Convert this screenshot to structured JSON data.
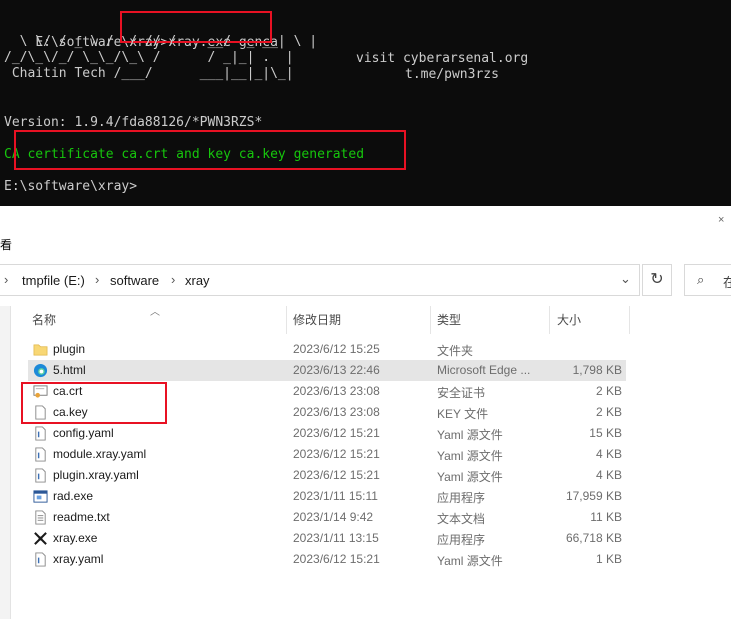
{
  "console": {
    "cmd_prompt": "E:\\software\\xray>",
    "cmd_text": "xray.exe genca",
    "banner": "  \\ \\/ / _ \\ /  / // /    __/  _ __| \\ |\n/_/\\_\\/_/ \\_\\_/\\_\\ /      / _|_| .  |\n Chaitin Tech /___/      ___|__|_|\\_|",
    "visit": "visit cyberarsenal.org",
    "tme": "t.me/pwn3rzs",
    "version": "Version: 1.9.4/fda88126/*PWN3RZS*",
    "ca_message": "CA certificate ca.crt and key ca.key generated",
    "prompt_end": "E:\\software\\xray>"
  },
  "explorer": {
    "view_label": "看",
    "breadcrumb": [
      "tmpfile (E:)",
      "software",
      "xray"
    ],
    "search_placeholder": "在",
    "columns": {
      "name": "名称",
      "date": "修改日期",
      "type": "类型",
      "size": "大小"
    },
    "files": [
      {
        "name": "plugin",
        "date": "2023/6/12 15:25",
        "type": "文件夹",
        "size": "",
        "icon": "folder-icon"
      },
      {
        "name": "5.html",
        "date": "2023/6/13 22:46",
        "type": "Microsoft Edge ...",
        "size": "1,798 KB",
        "icon": "edge-icon"
      },
      {
        "name": "ca.crt",
        "date": "2023/6/13 23:08",
        "type": "安全证书",
        "size": "2 KB",
        "icon": "certificate-icon"
      },
      {
        "name": "ca.key",
        "date": "2023/6/13 23:08",
        "type": "KEY 文件",
        "size": "2 KB",
        "icon": "file-icon"
      },
      {
        "name": "config.yaml",
        "date": "2023/6/12 15:21",
        "type": "Yaml 源文件",
        "size": "15 KB",
        "icon": "yaml-file-icon"
      },
      {
        "name": "module.xray.yaml",
        "date": "2023/6/12 15:21",
        "type": "Yaml 源文件",
        "size": "4 KB",
        "icon": "yaml-file-icon"
      },
      {
        "name": "plugin.xray.yaml",
        "date": "2023/6/12 15:21",
        "type": "Yaml 源文件",
        "size": "4 KB",
        "icon": "yaml-file-icon"
      },
      {
        "name": "rad.exe",
        "date": "2023/1/11 15:11",
        "type": "应用程序",
        "size": "17,959 KB",
        "icon": "exe-icon"
      },
      {
        "name": "readme.txt",
        "date": "2023/1/14 9:42",
        "type": "文本文档",
        "size": "11 KB",
        "icon": "text-file-icon"
      },
      {
        "name": "xray.exe",
        "date": "2023/1/11 13:15",
        "type": "应用程序",
        "size": "66,718 KB",
        "icon": "xray-exe-icon"
      },
      {
        "name": "xray.yaml",
        "date": "2023/6/12 15:21",
        "type": "Yaml 源文件",
        "size": "1 KB",
        "icon": "yaml-file-icon"
      }
    ]
  },
  "colors": {
    "highlight": "#e81123",
    "console_bg": "#0c0c0c",
    "console_green": "#16c60c"
  }
}
